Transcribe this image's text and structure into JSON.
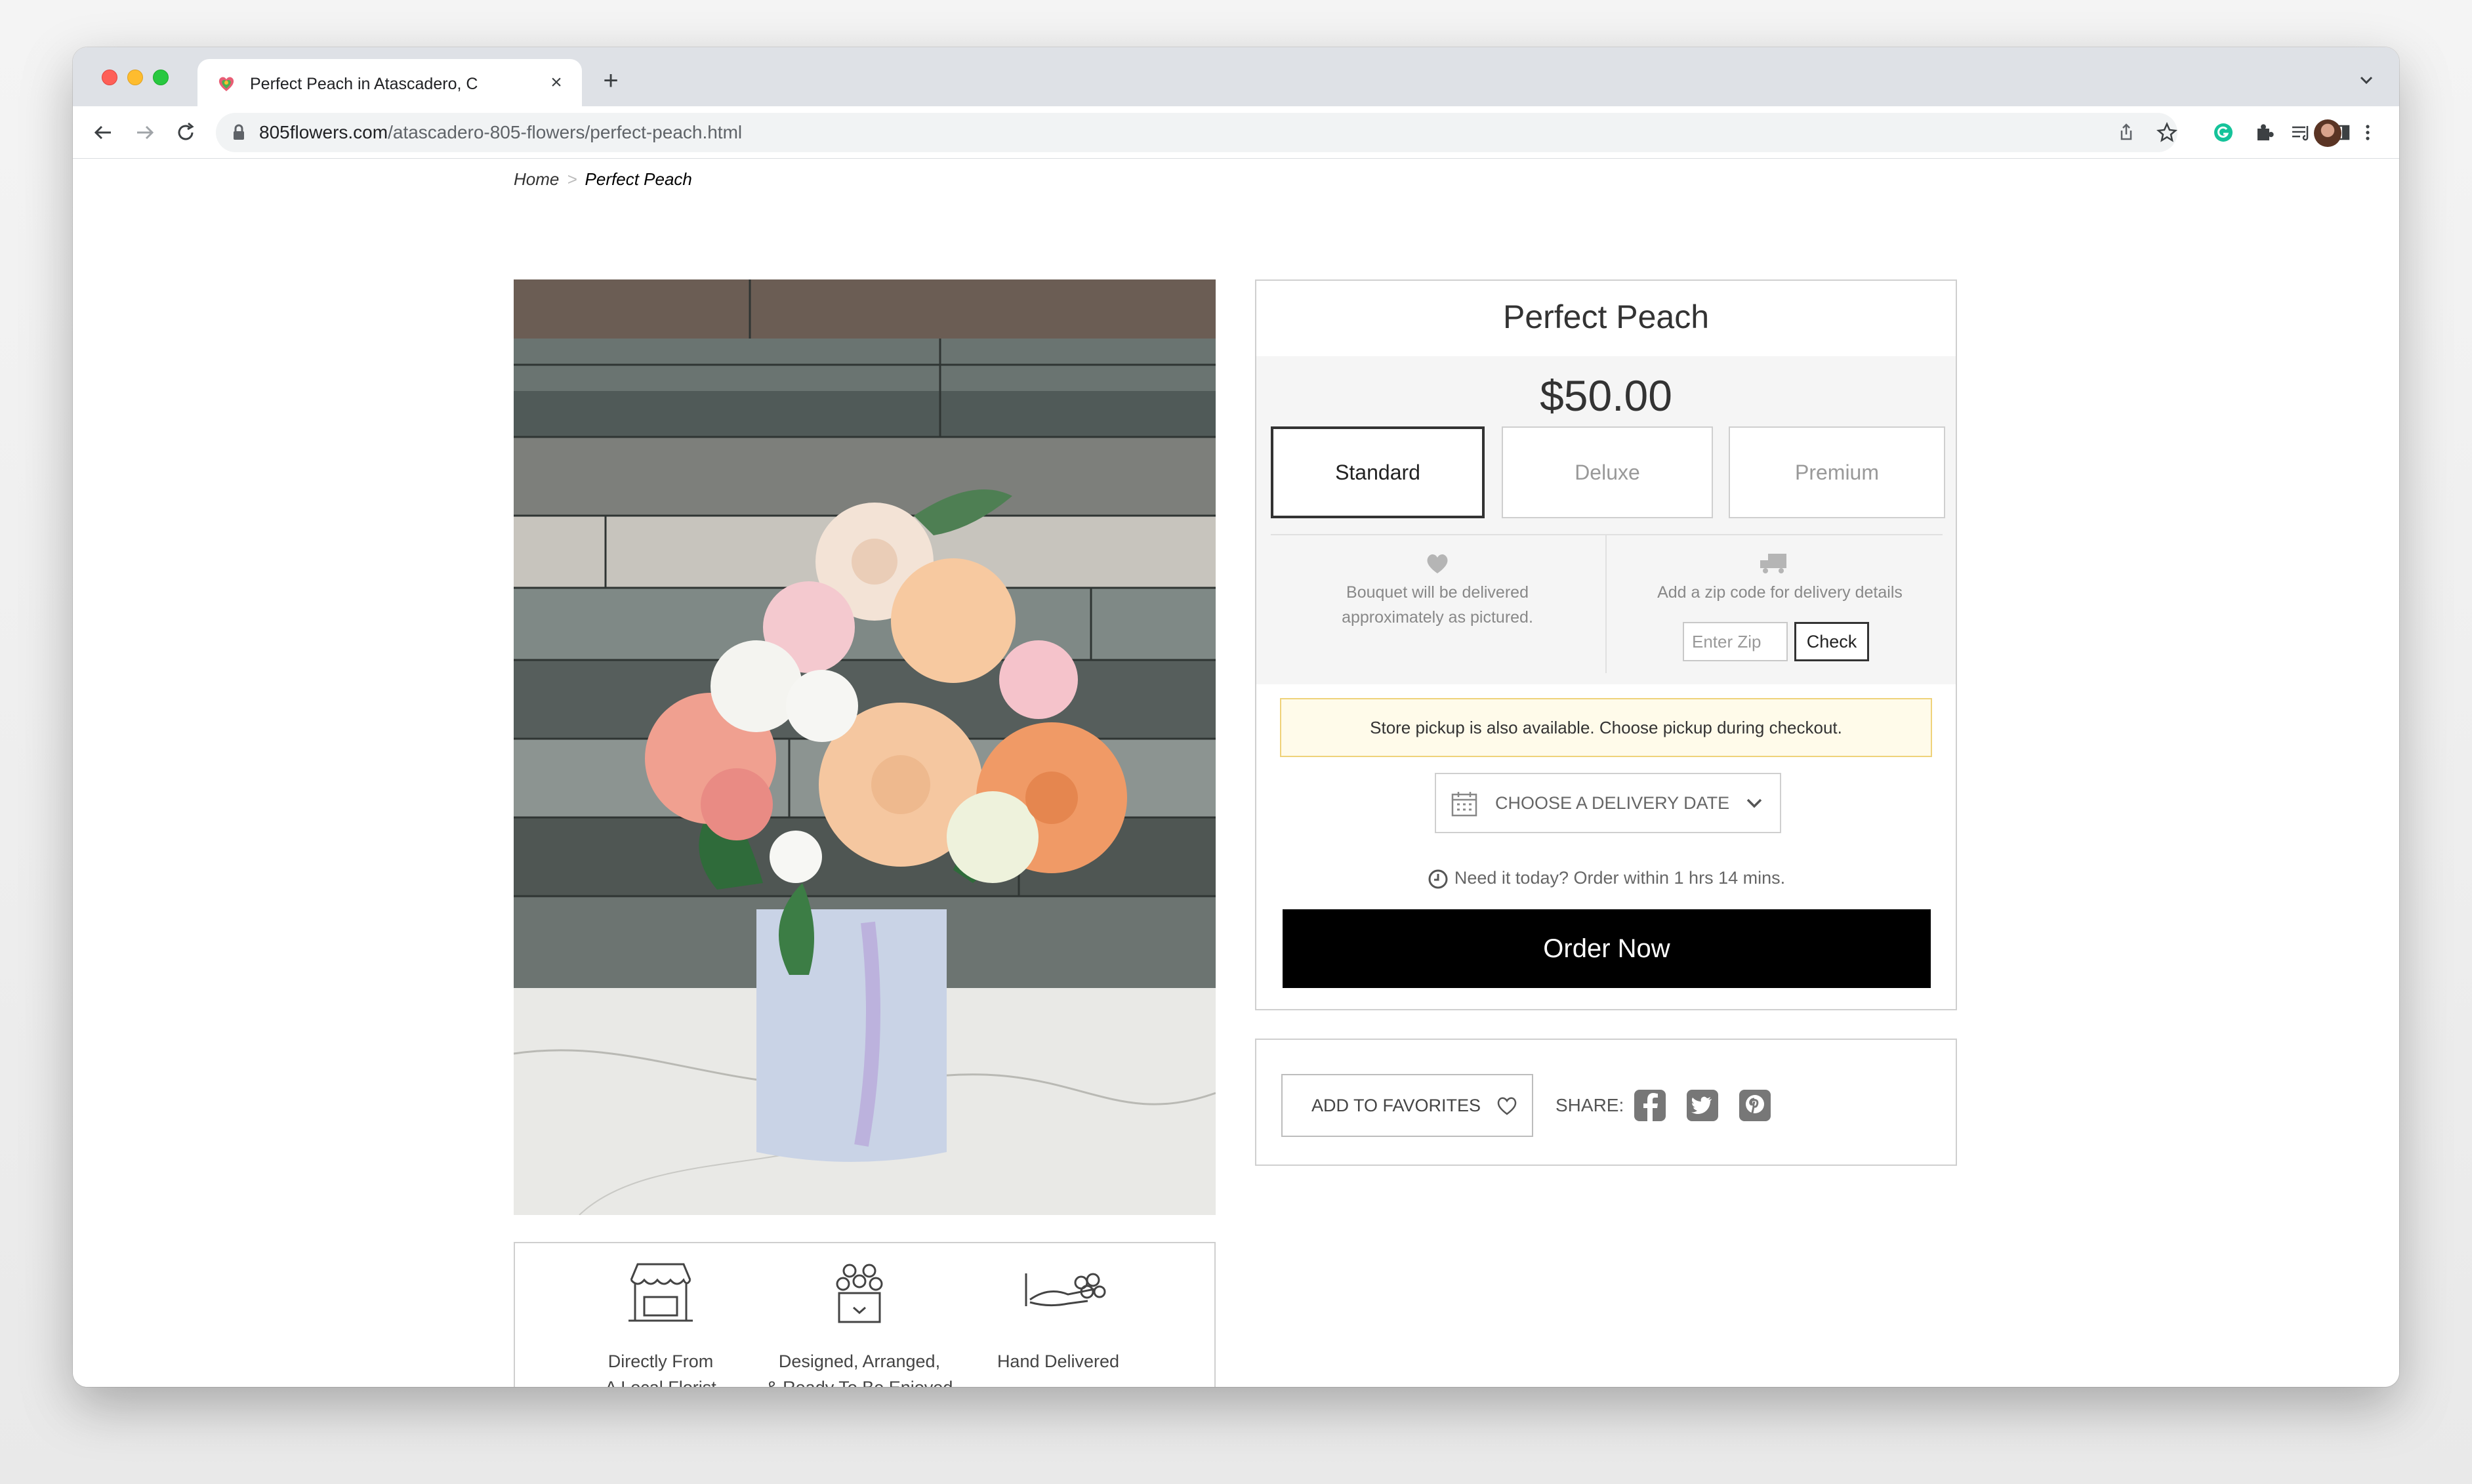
{
  "browser": {
    "tab_title": "Perfect Peach in Atascadero, C",
    "close_glyph": "×",
    "newtab_glyph": "+",
    "url_host": "805flowers.com",
    "url_path": "/atascadero-805-flowers/perfect-peach.html"
  },
  "breadcrumb": {
    "home": "Home",
    "separator": ">",
    "current": "Perfect Peach"
  },
  "product": {
    "title": "Perfect Peach",
    "price": "$50.00",
    "sizes": [
      {
        "label": "Standard",
        "selected": true
      },
      {
        "label": "Deluxe",
        "selected": false
      },
      {
        "label": "Premium",
        "selected": false
      }
    ],
    "delivery_note_line1": "Bouquet will be delivered",
    "delivery_note_line2": "approximately as pictured.",
    "zip_prompt": "Add a zip code for delivery details",
    "zip_placeholder": "Enter Zip",
    "check_label": "Check",
    "pickup_notice": "Store pickup is also available. Choose pickup during checkout.",
    "delivery_date_label": "CHOOSE A DELIVERY DATE",
    "need_today": "Need it today? Order within 1 hrs 14 mins.",
    "order_button": "Order Now"
  },
  "actions": {
    "favorites_label": "ADD TO FAVORITES",
    "share_label": "SHARE:",
    "social": [
      "facebook-icon",
      "twitter-icon",
      "pinterest-icon"
    ]
  },
  "features": [
    {
      "line1": "Directly From",
      "line2": "A Local Florist",
      "icon": "storefront-icon"
    },
    {
      "line1": "Designed, Arranged,",
      "line2": "& Ready To Be Enjoyed",
      "icon": "flower-box-icon"
    },
    {
      "line1": "Hand Delivered",
      "line2": "",
      "icon": "hand-bouquet-icon"
    }
  ],
  "colors": {
    "order_button_bg": "#000000",
    "pickup_bg": "#fffbea",
    "pickup_border": "#efd27a"
  }
}
